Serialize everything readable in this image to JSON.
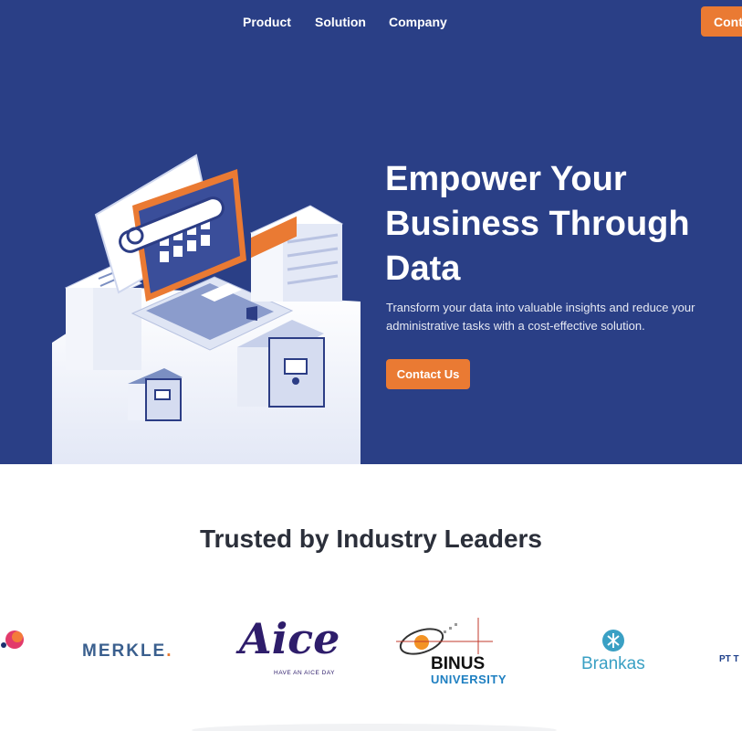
{
  "nav": {
    "links": [
      "Product",
      "Solution",
      "Company"
    ],
    "contact_label": "Contact"
  },
  "hero": {
    "title": "Empower Your Business Through Data",
    "subtitle": "Transform your data into valuable insights and reduce your administrative tasks with a cost-effective solution.",
    "cta_label": "Contact Us",
    "background": "#2a3f86",
    "accent": "#ea7a33"
  },
  "trusted": {
    "title": "Trusted by Industry Leaders",
    "logos": {
      "merkle": "MERKLE",
      "aice": "Aice",
      "aice_tagline": "HAVE AN AICE DAY",
      "binus": "BINUS",
      "binus_sub": "UNIVERSITY",
      "brankas": "Brankas",
      "pt": "PT T"
    }
  }
}
